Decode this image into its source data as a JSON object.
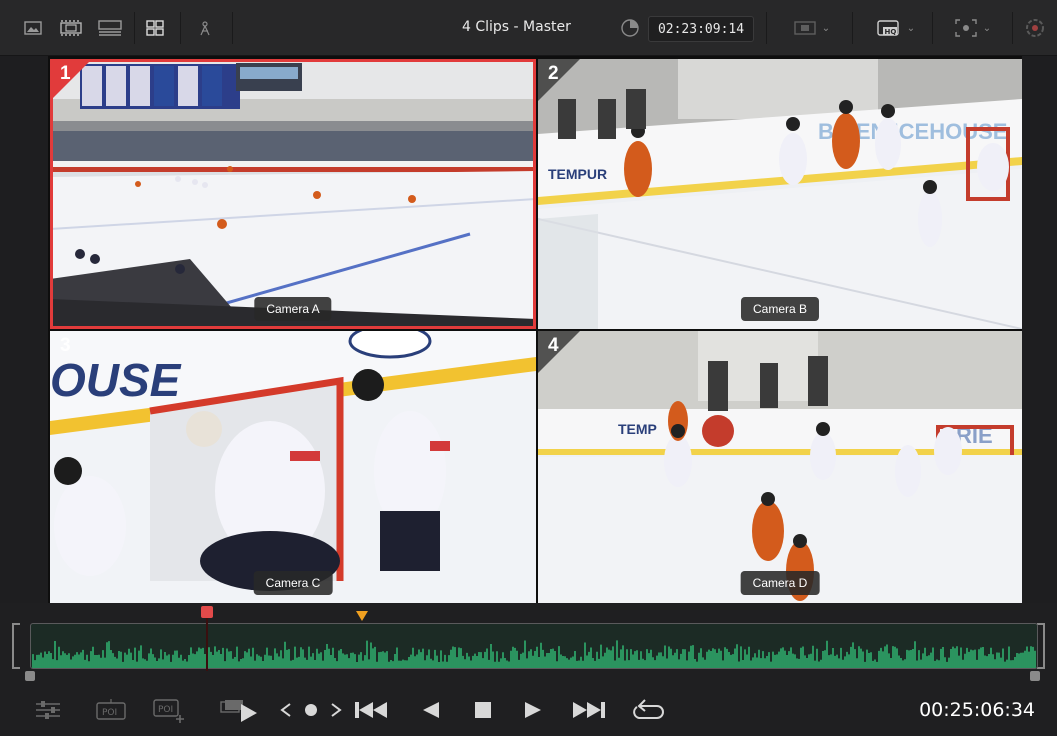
{
  "toolbar": {
    "title": "4 Clips - Master",
    "timecode": "02:23:09:14",
    "hq_label": "HQ"
  },
  "viewer": {
    "tiles": [
      {
        "number": "1",
        "camera": "Camera A",
        "selected": true
      },
      {
        "number": "2",
        "camera": "Camera B",
        "selected": false
      },
      {
        "number": "3",
        "camera": "Camera C",
        "selected": false
      },
      {
        "number": "4",
        "camera": "Camera D",
        "selected": false
      }
    ],
    "selection_color": "#e13b3b"
  },
  "timeline": {
    "waveform_color": "#2fae6e",
    "playhead_color": "#e24a4a",
    "marker_color": "#f0a020"
  },
  "transport": {
    "timecode": "00:25:06:34",
    "poi_label": "POI"
  }
}
